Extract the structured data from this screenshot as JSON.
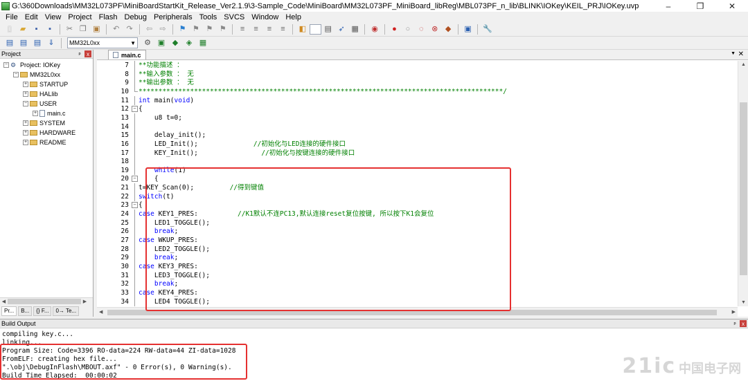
{
  "window": {
    "title": "G:\\360Downloads\\MM32L073PF\\MiniBoardStartKit_Release_Ver2.1.9\\3-Sample_Code\\MiniBoard\\MM32L073PF_MiniBoard_libReg\\MBL073PF_n_lib\\BLINK\\IOKey\\KEIL_PRJ\\IOKey.uvp",
    "minimize": "–",
    "maximize": "❐",
    "close": "✕"
  },
  "menu": [
    "File",
    "Edit",
    "View",
    "Project",
    "Flash",
    "Debug",
    "Peripherals",
    "Tools",
    "SVCS",
    "Window",
    "Help"
  ],
  "toolbar": {
    "target": "MM32L0xx"
  },
  "project_panel": {
    "header": "Project",
    "pin": "ᵖ",
    "close": "x",
    "tree": [
      {
        "label": "Project: IOKey",
        "expander": "−",
        "kind": "project"
      },
      {
        "label": "MM32L0xx",
        "expander": "−",
        "kind": "folder"
      },
      {
        "label": "STARTUP",
        "expander": "+",
        "kind": "folder"
      },
      {
        "label": "HALlib",
        "expander": "+",
        "kind": "folder"
      },
      {
        "label": "USER",
        "expander": "−",
        "kind": "folder"
      },
      {
        "label": "main.c",
        "expander": "+",
        "kind": "file"
      },
      {
        "label": "SYSTEM",
        "expander": "+",
        "kind": "folder"
      },
      {
        "label": "HARDWARE",
        "expander": "+",
        "kind": "folder"
      },
      {
        "label": "README",
        "expander": "+",
        "kind": "folder"
      }
    ],
    "bottom_tabs": [
      "Pr...",
      "B...",
      "{} F...",
      "0→ Te..."
    ]
  },
  "editor": {
    "tab": "main.c",
    "close": "✕",
    "menu": "▼",
    "lines": [
      {
        "n": "7",
        "text": "**功能描述 ：",
        "kind": "comment"
      },
      {
        "n": "8",
        "text": "**输入参数 ： 无",
        "kind": "comment"
      },
      {
        "n": "9",
        "text": "**输出参数 ： 无",
        "kind": "comment"
      },
      {
        "n": "10",
        "text": "********************************************************************************************/",
        "kind": "comment"
      },
      {
        "n": "11",
        "text": "int main(void)",
        "kind": "main"
      },
      {
        "n": "12",
        "text": "{",
        "kind": "plain"
      },
      {
        "n": "13",
        "text": "    u8 t=0;",
        "kind": "plain"
      },
      {
        "n": "14",
        "text": "",
        "kind": "plain"
      },
      {
        "n": "15",
        "text": "    delay_init();",
        "kind": "plain"
      },
      {
        "n": "16",
        "text": "    LED_Init();",
        "comment": "//初始化与LED连接的硬件接口",
        "kind": "code-comment"
      },
      {
        "n": "17",
        "text": "    KEY_Init();",
        "comment": "//初始化与按键连接的硬件接口",
        "kind": "code-comment"
      },
      {
        "n": "18",
        "text": "",
        "kind": "plain"
      },
      {
        "n": "19",
        "text": "    while(1)",
        "kind": "kw-line",
        "kw": "while",
        "before": "    ",
        "after": "(1)"
      },
      {
        "n": "20",
        "text": "    {",
        "kind": "plain"
      },
      {
        "n": "21",
        "text": "t=KEY_Scan(0);",
        "comment": "//得到键值",
        "kind": "code-comment"
      },
      {
        "n": "22",
        "text": "switch(t)",
        "kind": "kw-line",
        "kw": "switch",
        "before": "",
        "after": "(t)"
      },
      {
        "n": "23",
        "text": "{",
        "kind": "plain"
      },
      {
        "n": "24",
        "text": "case KEY1_PRES:",
        "comment": "//K1默认不连PC13,默认连接reset复位按键, 所以按下K1会复位",
        "kind": "case"
      },
      {
        "n": "25",
        "text": "    LED1_TOGGLE();",
        "kind": "plain"
      },
      {
        "n": "26",
        "text": "    break;",
        "kind": "kw-line",
        "kw": "break",
        "before": "    ",
        "after": ";"
      },
      {
        "n": "27",
        "text": "case WKUP_PRES:",
        "kind": "case"
      },
      {
        "n": "28",
        "text": "    LED2_TOGGLE();",
        "kind": "plain"
      },
      {
        "n": "29",
        "text": "    break;",
        "kind": "kw-line",
        "kw": "break",
        "before": "    ",
        "after": ";"
      },
      {
        "n": "30",
        "text": "case KEY3_PRES:",
        "kind": "case"
      },
      {
        "n": "31",
        "text": "    LED3_TOGGLE();",
        "kind": "plain"
      },
      {
        "n": "32",
        "text": "    break;",
        "kind": "kw-line",
        "kw": "break",
        "before": "    ",
        "after": ";"
      },
      {
        "n": "33",
        "text": "case KEY4_PRES:",
        "kind": "case"
      },
      {
        "n": "34",
        "text": "    LED4 TOGGLE();",
        "kind": "plain"
      }
    ]
  },
  "build_output": {
    "header": "Build Output",
    "pin": "ᵖ",
    "close": "x",
    "lines": [
      "compiling key.c...",
      "linking...",
      "Program Size: Code=3396 RO-data=224 RW-data=44 ZI-data=1028",
      "FromELF: creating hex file...",
      "\".\\obj\\DebugInFlash\\MBOUT.axf\" - 0 Error(s), 0 Warning(s).",
      "Build Time Elapsed:  00:00:02"
    ]
  },
  "watermark": {
    "logo": "21ic",
    "text": "中国电子网"
  },
  "colors": {
    "keyword": "#0000ff",
    "comment": "#008000",
    "highlight_box": "#e53030"
  }
}
